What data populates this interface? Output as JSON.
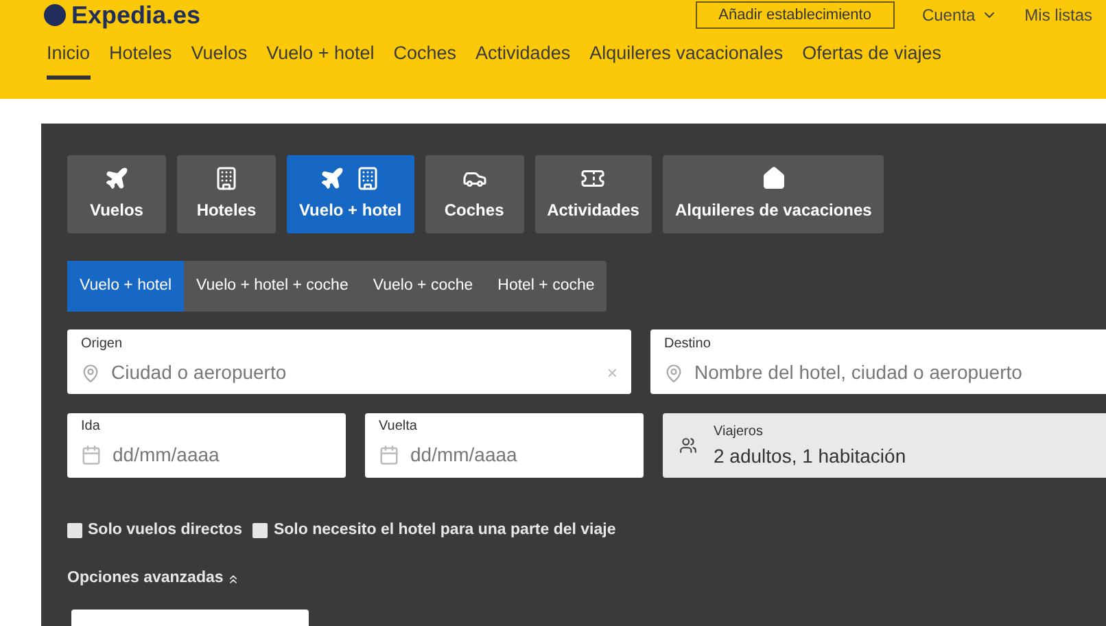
{
  "header": {
    "logo": "Expedia.es",
    "actions": [
      {
        "kind": "button",
        "label": "Añadir establecimiento"
      },
      {
        "kind": "menu",
        "label": "Cuenta"
      },
      {
        "kind": "link",
        "label": "Mis listas"
      }
    ]
  },
  "nav": [
    {
      "label": "Inicio",
      "selected": true
    },
    {
      "label": "Hoteles",
      "selected": false
    },
    {
      "label": "Vuelos",
      "selected": false
    },
    {
      "label": "Vuelo + hotel",
      "selected": false
    },
    {
      "label": "Coches",
      "selected": false
    },
    {
      "label": "Actividades",
      "selected": false
    },
    {
      "label": "Alquileres vacacionales",
      "selected": false
    },
    {
      "label": "Ofertas de viajes",
      "selected": false
    }
  ],
  "product_tabs": [
    {
      "kind": "flight",
      "label": "Vuelos",
      "selected": false
    },
    {
      "kind": "hotel",
      "label": "Hoteles",
      "selected": false
    },
    {
      "kind": "package",
      "label": "Vuelo + hotel",
      "selected": true
    },
    {
      "kind": "car",
      "label": "Coches",
      "selected": false
    },
    {
      "kind": "activity",
      "label": "Actividades",
      "selected": false
    },
    {
      "kind": "rental",
      "label": "Alquileres de vacaciones",
      "selected": false
    }
  ],
  "sub_tabs": [
    {
      "label": "Vuelo + hotel",
      "selected": true
    },
    {
      "label": "Vuelo + hotel + coche",
      "selected": false
    },
    {
      "label": "Vuelo + coche",
      "selected": false
    },
    {
      "label": "Hotel + coche",
      "selected": false
    }
  ],
  "origin": {
    "label": "Origen",
    "placeholder": "Ciudad o aeropuerto",
    "clear": "×"
  },
  "destination": {
    "label": "Destino",
    "placeholder": "Nombre del hotel, ciudad o aeropuerto"
  },
  "departure": {
    "label": "Ida",
    "placeholder": "dd/mm/aaaa"
  },
  "return": {
    "label": "Vuelta",
    "placeholder": "dd/mm/aaaa"
  },
  "travelers": {
    "label": "Viajeros",
    "value": "2 adultos, 1 habitación"
  },
  "options": [
    {
      "label": "Solo vuelos directos",
      "checked": false
    },
    {
      "label": "Solo necesito el hotel para una parte del viaje",
      "checked": false
    }
  ],
  "advanced": {
    "label": "Opciones avanzadas",
    "expanded": true
  }
}
